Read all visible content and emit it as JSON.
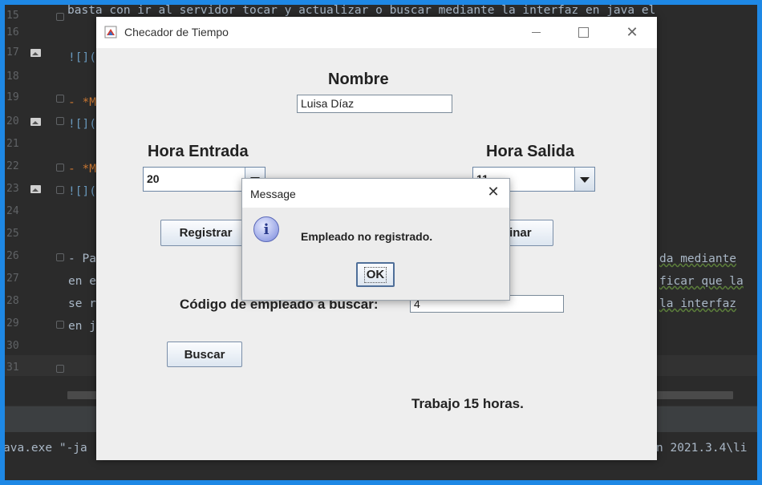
{
  "ide": {
    "line_numbers": [
      "15",
      "16",
      "17",
      "18",
      "19",
      "20",
      "21",
      "22",
      "23",
      "24",
      "25",
      "26",
      "27",
      "28",
      "29",
      "30",
      "31"
    ],
    "code_lines": {
      "line15": "basta con ir al servidor tocar y actualizar o buscar mediante la interfaz en java el",
      "line17": "![](",
      "line19": "- *M",
      "line20": "![](",
      "line22": "- *M",
      "line23": "![](",
      "line26_left": "- Pa",
      "line26_right": "da mediante",
      "line27_left": "en e",
      "line27_right": "ficar que la",
      "line28_left": "se r",
      "line28_right": "la interfaz",
      "line29_left": "en j"
    },
    "console": {
      "left": "ava.exe \"-ja",
      "right": "n 2021.3.4\\li"
    }
  },
  "window": {
    "title": "Checador de Tiempo",
    "nombre_label": "Nombre",
    "nombre_value": "Luisa  Díaz",
    "hora_entrada_label": "Hora Entrada",
    "hora_entrada_value": "20",
    "hora_salida_label": "Hora Salida",
    "hora_salida_value": "11",
    "registrar_label": "Registrar",
    "eliminar_label": "Eliminar",
    "codigo_label": "Código de empleado a buscar:",
    "codigo_value": "4",
    "buscar_label": "Buscar",
    "result_text": "Trabajo 15 horas."
  },
  "dialog": {
    "title": "Message",
    "message": "Empleado no registrado.",
    "ok_label": "OK",
    "icon": "information-icon"
  },
  "colors": {
    "desktop_border": "#1e88e5",
    "ide_background": "#2b2b2b",
    "window_background": "#eeeeee"
  }
}
